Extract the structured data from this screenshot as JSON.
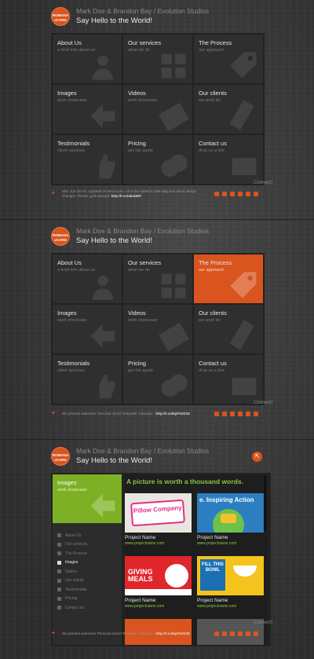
{
  "header": {
    "logo_line1": "ROMANA",
    "logo_line2": "vCARD",
    "names": "Mark Doe & Brandon Bay / Evolution Studios",
    "hello": "Say Hello to the World!"
  },
  "tiles": [
    {
      "title": "About Us",
      "sub": "a brief info about us",
      "icon": "person-icon"
    },
    {
      "title": "Our services",
      "sub": "what we do",
      "icon": "grid-icon"
    },
    {
      "title": "The Process",
      "sub": "our approach",
      "icon": "tag-icon"
    },
    {
      "title": "Images",
      "sub": "work showcase",
      "icon": "image-icon"
    },
    {
      "title": "Videos",
      "sub": "work showcase",
      "icon": "film-icon"
    },
    {
      "title": "Our clients",
      "sub": "we work for",
      "icon": "clients-icon"
    },
    {
      "title": "Testimonials",
      "sub": "client opinions",
      "icon": "thumb-icon"
    },
    {
      "title": "Pricing",
      "sub": "get the quote",
      "icon": "coins-icon"
    },
    {
      "title": "Contact us",
      "sub": "drop us a line",
      "icon": "mail-icon"
    }
  ],
  "footer1": {
    "tweet": "Mon Jun 1st #1: Updated 20 New icons. All icons Added to Site Map and minor design changes. Please go/download:",
    "link": "http://t.co/abcDEF"
  },
  "footer2": {
    "tweet": "We present awesome Personal vCard Template: Cascado -",
    "link": "http://t.co/kpFSzK33"
  },
  "footer3": {
    "tweet": "We present awesome Personal vCard Template: Cascado -",
    "link": "http://t.co/kpFSzK33"
  },
  "connect": "Connect!",
  "social_icons": [
    "rss-icon",
    "facebook-icon",
    "twitter-icon",
    "linkedin-icon",
    "grid-icon",
    "xing-icon"
  ],
  "images_page": {
    "tile_title": "Images",
    "tile_sub": "work showcase",
    "heading": "A picture is worth a thousand words.",
    "nav": [
      {
        "label": "About Us",
        "current": false
      },
      {
        "label": "Our services",
        "current": false
      },
      {
        "label": "The Process",
        "current": false
      },
      {
        "label": "Images",
        "current": true
      },
      {
        "label": "Videos",
        "current": false
      },
      {
        "label": "Our clients",
        "current": false
      },
      {
        "label": "Testimonials",
        "current": false
      },
      {
        "label": "Pricing",
        "current": false
      },
      {
        "label": "Contact us",
        "current": false
      }
    ],
    "projects": [
      {
        "name": "Project Name",
        "url": "www.projectname.com",
        "thumb_text": "Pillow Company"
      },
      {
        "name": "Project Name",
        "url": "www.projectname.com",
        "thumb_text": "e. Inspiring Action"
      },
      {
        "name": "Project Name",
        "url": "www.projectname.com",
        "thumb_text": "GIVING MEALS"
      },
      {
        "name": "Project Name",
        "url": "www.projectname.com",
        "thumb_text": "FILL THIS BOWL"
      }
    ]
  },
  "colors": {
    "accent": "#d9541e",
    "green": "#7db024",
    "tile": "#2f2f2f"
  }
}
